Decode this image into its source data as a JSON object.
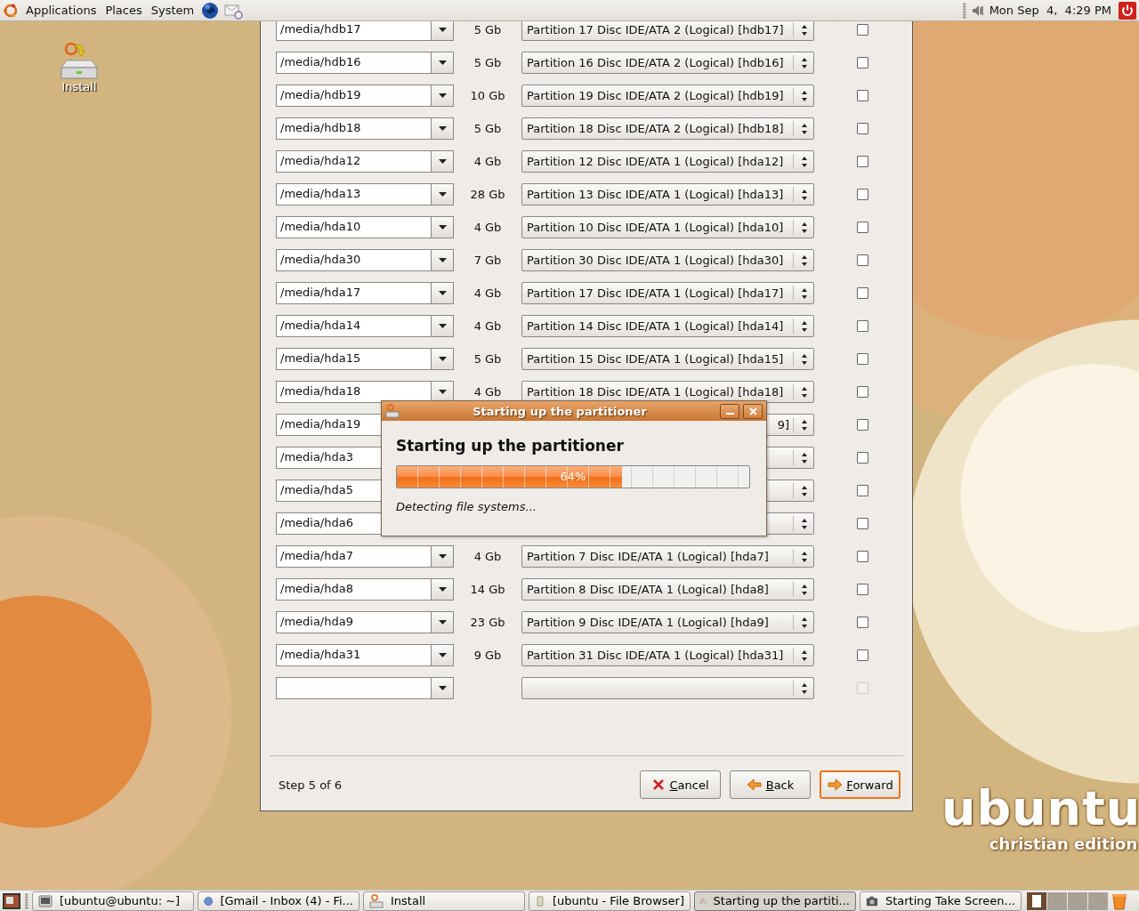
{
  "top_panel": {
    "menus": [
      "Applications",
      "Places",
      "System"
    ],
    "clock": "Mon Sep  4,  4:29 PM"
  },
  "desktop_icons": [
    {
      "label": "Install"
    }
  ],
  "installer": {
    "rows": [
      {
        "mount": "/media/hdb17",
        "size": "5 Gb",
        "partition": "Partition 17 Disc IDE/ATA 2 (Logical) [hdb17]",
        "checked": false,
        "disabled": false,
        "covered": false
      },
      {
        "mount": "/media/hdb16",
        "size": "5 Gb",
        "partition": "Partition 16 Disc IDE/ATA 2 (Logical) [hdb16]",
        "checked": false,
        "disabled": false,
        "covered": false
      },
      {
        "mount": "/media/hdb19",
        "size": "10 Gb",
        "partition": "Partition 19 Disc IDE/ATA 2 (Logical) [hdb19]",
        "checked": false,
        "disabled": false,
        "covered": false
      },
      {
        "mount": "/media/hdb18",
        "size": "5 Gb",
        "partition": "Partition 18 Disc IDE/ATA 2 (Logical) [hdb18]",
        "checked": false,
        "disabled": false,
        "covered": false
      },
      {
        "mount": "/media/hda12",
        "size": "4 Gb",
        "partition": "Partition 12 Disc IDE/ATA 1 (Logical) [hda12]",
        "checked": false,
        "disabled": false,
        "covered": false
      },
      {
        "mount": "/media/hda13",
        "size": "28 Gb",
        "partition": "Partition 13 Disc IDE/ATA 1 (Logical) [hda13]",
        "checked": false,
        "disabled": false,
        "covered": false
      },
      {
        "mount": "/media/hda10",
        "size": "4 Gb",
        "partition": "Partition 10 Disc IDE/ATA 1 (Logical) [hda10]",
        "checked": false,
        "disabled": false,
        "covered": false
      },
      {
        "mount": "/media/hda30",
        "size": "7 Gb",
        "partition": "Partition 30 Disc IDE/ATA 1 (Logical) [hda30]",
        "checked": false,
        "disabled": false,
        "covered": false
      },
      {
        "mount": "/media/hda17",
        "size": "4 Gb",
        "partition": "Partition 17 Disc IDE/ATA 1 (Logical) [hda17]",
        "checked": false,
        "disabled": false,
        "covered": false
      },
      {
        "mount": "/media/hda14",
        "size": "4 Gb",
        "partition": "Partition 14 Disc IDE/ATA 1 (Logical) [hda14]",
        "checked": false,
        "disabled": false,
        "covered": false
      },
      {
        "mount": "/media/hda15",
        "size": "5 Gb",
        "partition": "Partition 15 Disc IDE/ATA 1 (Logical) [hda15]",
        "checked": false,
        "disabled": false,
        "covered": false
      },
      {
        "mount": "/media/hda18",
        "size": "4 Gb",
        "partition": "Partition 18 Disc IDE/ATA 1 (Logical) [hda18]",
        "checked": false,
        "disabled": false,
        "covered": false
      },
      {
        "mount": "/media/hda19",
        "partition": "9]",
        "checked": false,
        "disabled": false,
        "covered": true
      },
      {
        "mount": "/media/hda3",
        "checked": false,
        "disabled": false,
        "covered": true
      },
      {
        "mount": "/media/hda5",
        "checked": false,
        "disabled": false,
        "covered": true
      },
      {
        "mount": "/media/hda6",
        "checked": false,
        "disabled": false,
        "covered": true
      },
      {
        "mount": "/media/hda7",
        "size": "4 Gb",
        "partition": "Partition 7 Disc IDE/ATA 1 (Logical) [hda7]",
        "checked": false,
        "disabled": false,
        "covered": false
      },
      {
        "mount": "/media/hda8",
        "size": "14 Gb",
        "partition": "Partition 8 Disc IDE/ATA 1 (Logical) [hda8]",
        "checked": false,
        "disabled": false,
        "covered": false
      },
      {
        "mount": "/media/hda9",
        "size": "23 Gb",
        "partition": "Partition 9 Disc IDE/ATA 1 (Logical) [hda9]",
        "checked": false,
        "disabled": false,
        "covered": false
      },
      {
        "mount": "/media/hda31",
        "size": "9 Gb",
        "partition": "Partition 31 Disc IDE/ATA 1 (Logical) [hda31]",
        "checked": false,
        "disabled": false,
        "covered": false
      },
      {
        "checked": false,
        "disabled": true,
        "covered": false
      }
    ],
    "step": "Step 5 of 6",
    "buttons": [
      {
        "label": "Cancel",
        "kind": "cancel",
        "focused": false
      },
      {
        "label": "Back",
        "kind": "back",
        "focused": false
      },
      {
        "label": "Forward",
        "kind": "forward",
        "focused": true
      }
    ]
  },
  "dialog": {
    "title": "Starting up the partitioner",
    "heading": "Starting up the partitioner",
    "progress": {
      "level": 0.64,
      "text": "64%"
    },
    "status": "Detecting file systems..."
  },
  "branding": {
    "name": "ubuntu",
    "edition": "christian edition"
  },
  "taskbar": {
    "items": [
      {
        "label": "[ubuntu@ubuntu: ~]",
        "kind": "terminal",
        "selected": false
      },
      {
        "label": "[Gmail - Inbox (4) - Fi...",
        "kind": "browser",
        "selected": false
      },
      {
        "label": "Install",
        "kind": "installer",
        "selected": false
      },
      {
        "label": "[ubuntu - File Browser]",
        "kind": "folder",
        "selected": false
      },
      {
        "label": "Starting up the partiti...",
        "kind": "installer",
        "selected": true
      },
      {
        "label": "Starting Take Screen...",
        "kind": "camera",
        "selected": false
      }
    ],
    "workspaces": [
      {
        "selected": true
      },
      {
        "selected": false
      },
      {
        "selected": false
      },
      {
        "selected": false
      }
    ]
  }
}
